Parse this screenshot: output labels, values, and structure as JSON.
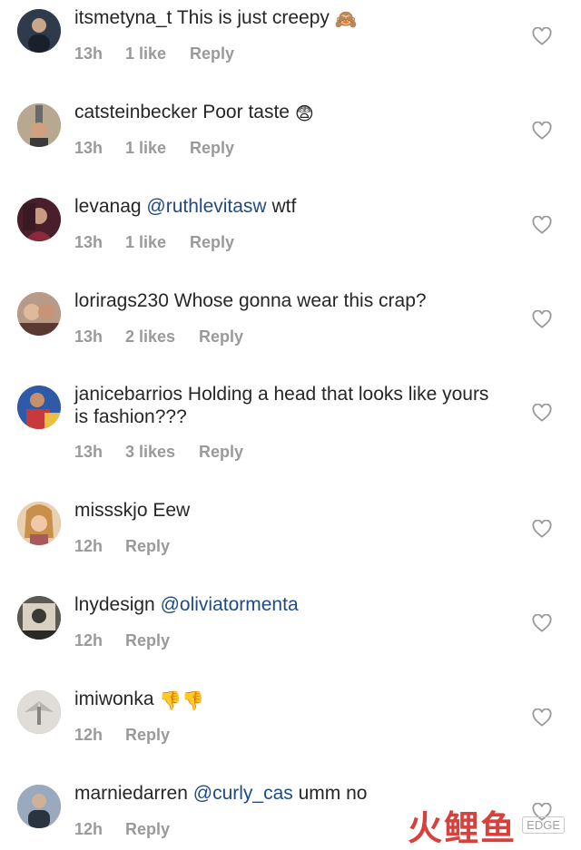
{
  "comments": [
    {
      "username": "itsmetyna_t",
      "text": "This is just creepy",
      "emoji": "🙈",
      "time": "13h",
      "likes": "1 like",
      "reply": "Reply",
      "avatar_color": "#3c4a5e"
    },
    {
      "username": "catsteinbecker",
      "text": "Poor taste",
      "emoji": "😨",
      "time": "13h",
      "likes": "1 like",
      "reply": "Reply",
      "avatar_color": "#8a7a6a"
    },
    {
      "username": "levanag",
      "mention": "@ruthlevitasw",
      "text": "wtf",
      "time": "13h",
      "likes": "1 like",
      "reply": "Reply",
      "avatar_color": "#5a2e3a"
    },
    {
      "username": "lorirags230",
      "text": "Whose gonna wear this crap?",
      "time": "13h",
      "likes": "2 likes",
      "reply": "Reply",
      "avatar_color": "#9a7a6a"
    },
    {
      "username": "janicebarrios",
      "text": "Holding a head that looks like yours is fashion???",
      "time": "13h",
      "likes": "3 likes",
      "reply": "Reply",
      "avatar_color": "#3a5aa8"
    },
    {
      "username": "missskjo",
      "text": "Eew",
      "time": "12h",
      "reply": "Reply",
      "avatar_color": "#c8a07a"
    },
    {
      "username": "lnydesign",
      "mention": "@oliviatormenta",
      "time": "12h",
      "reply": "Reply",
      "avatar_color": "#6a6a60"
    },
    {
      "username": "imiwonka",
      "emoji": "👎👎",
      "time": "12h",
      "reply": "Reply",
      "avatar_color": "#d8d4d0"
    },
    {
      "username": "marniedarren",
      "mention": "@curly_cas",
      "text": "umm no",
      "time": "12h",
      "reply": "Reply",
      "avatar_color": "#7a8aa0"
    }
  ],
  "watermark": {
    "logo": "火鲤鱼",
    "label": "EDGE"
  },
  "colors": {
    "text": "#262626",
    "meta": "#9a9a9a",
    "mention": "#1f4a86",
    "heart_stroke": "#9a9a9a"
  }
}
